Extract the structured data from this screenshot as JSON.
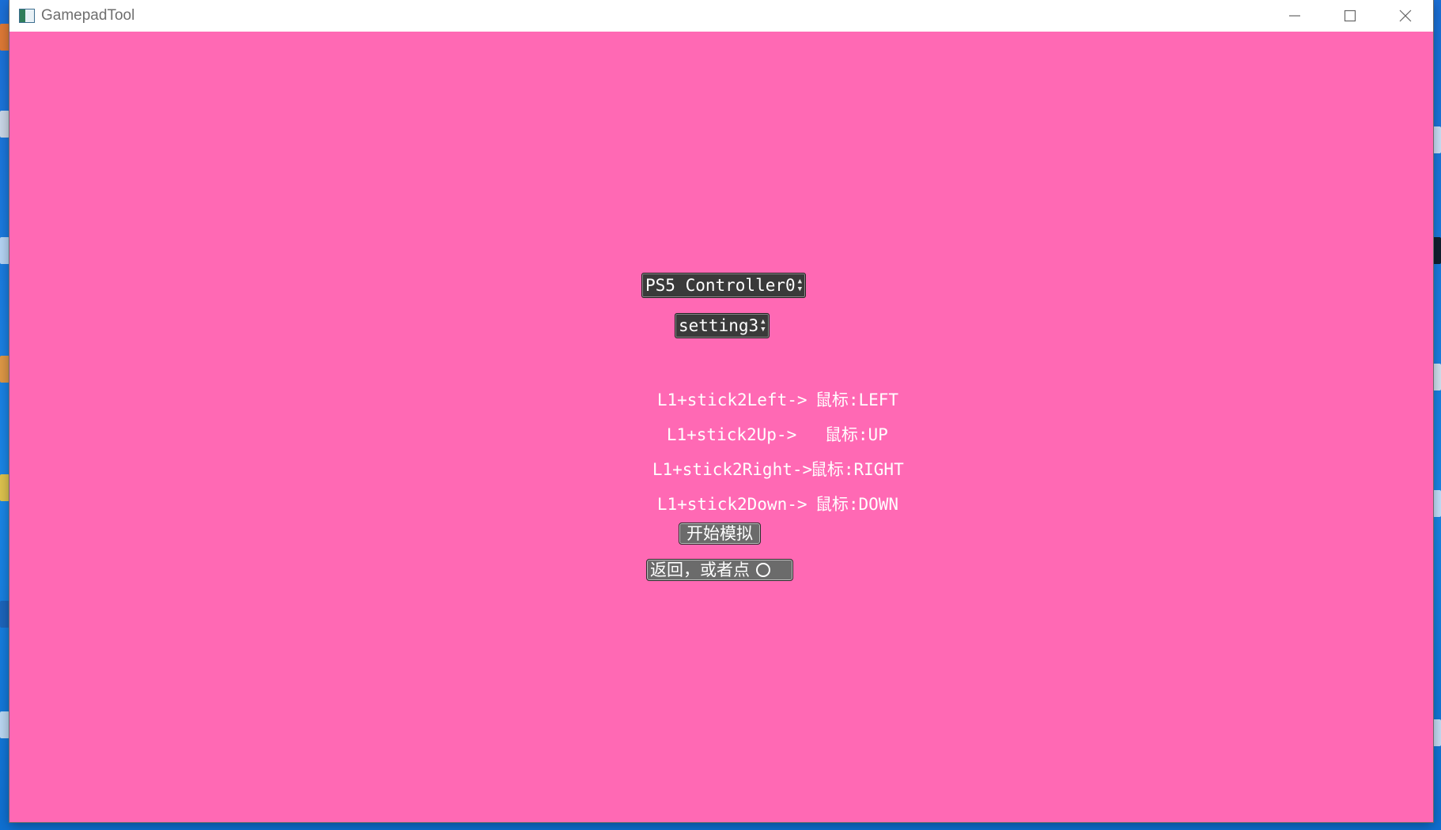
{
  "window": {
    "title": "GamepadTool",
    "controls": {
      "minimize": "minimize-icon",
      "maximize": "maximize-icon",
      "close": "close-icon"
    }
  },
  "colors": {
    "background": "#ff69b4",
    "picker": "#3a3a3a",
    "button": "#6b6b6b",
    "text": "#ffffff"
  },
  "controller_picker": {
    "value": "PS5 Controller0"
  },
  "setting_picker": {
    "value": "setting3"
  },
  "mappings": [
    {
      "input": "L1+stick2Left->",
      "output": "鼠标:LEFT"
    },
    {
      "input": "L1+stick2Up->",
      "output": "鼠标:UP"
    },
    {
      "input": "L1+stick2Right->",
      "output": "鼠标:RIGHT"
    },
    {
      "input": "L1+stick2Down->",
      "output": "鼠标:DOWN"
    }
  ],
  "buttons": {
    "start": "开始模拟",
    "back": "返回，或者点"
  }
}
